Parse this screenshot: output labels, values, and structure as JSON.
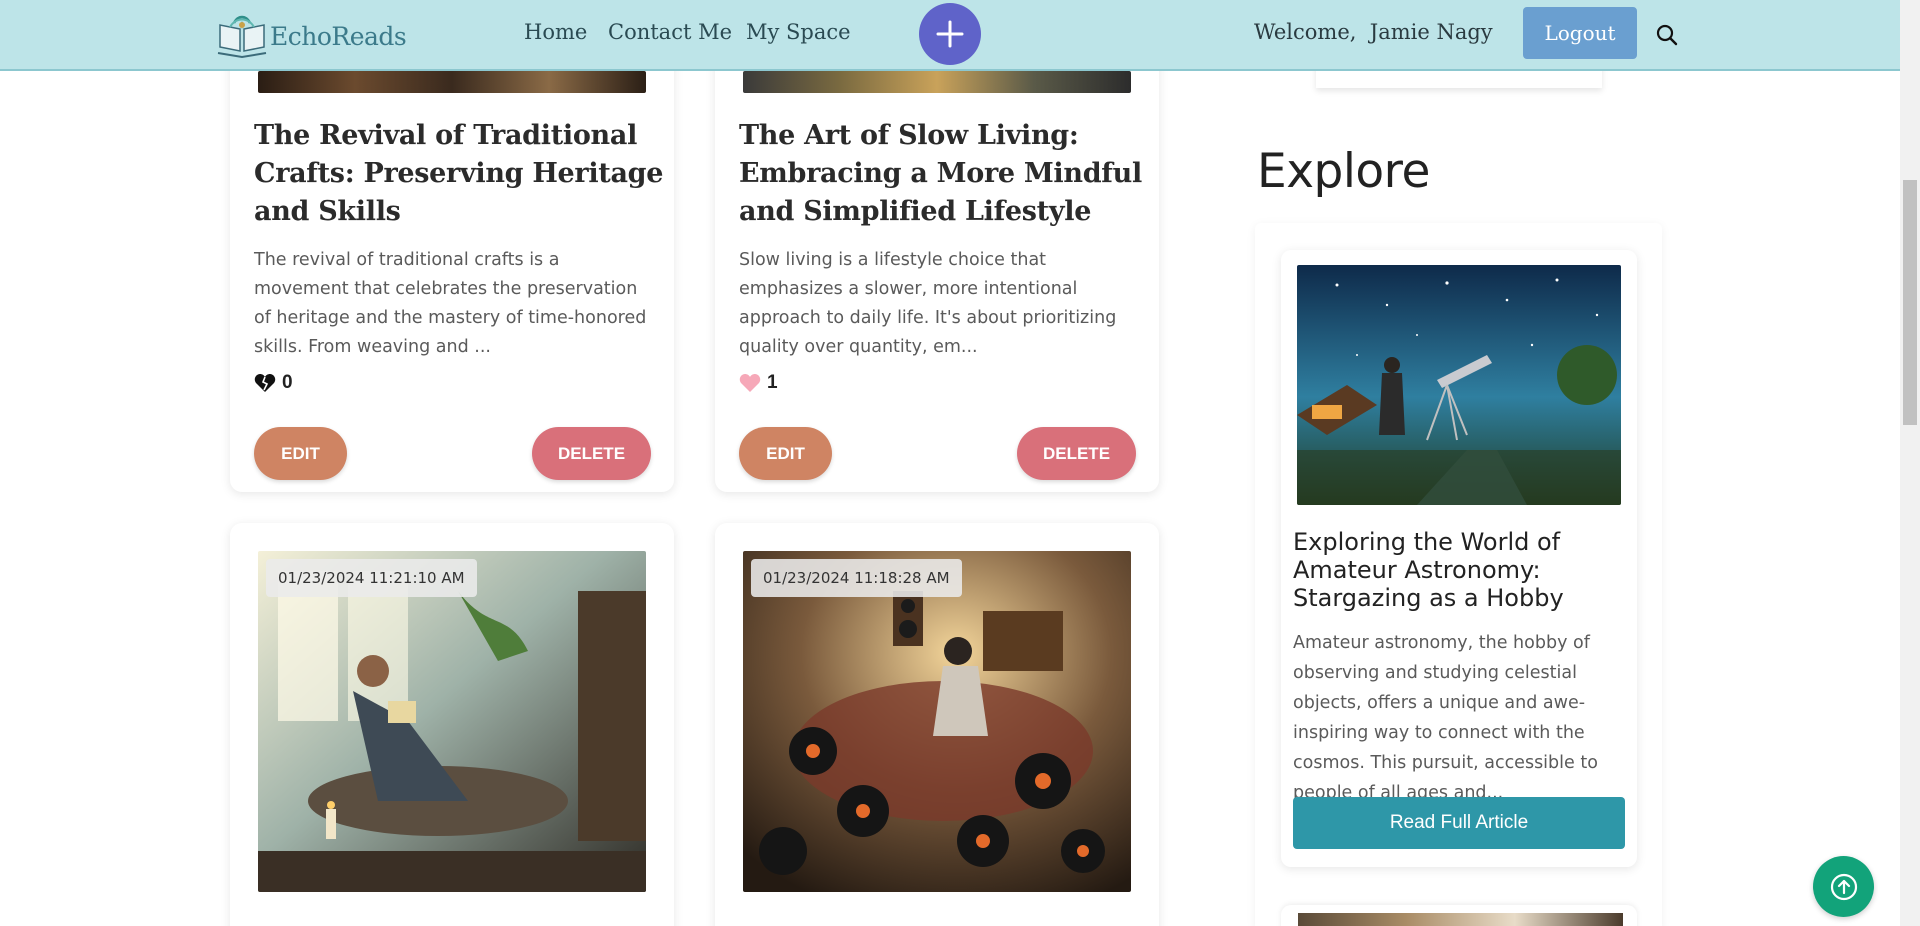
{
  "brand": {
    "name": "EchoReads"
  },
  "nav": {
    "links": [
      "Home",
      "Contact Me",
      "My Space"
    ],
    "add_icon": "plus-icon",
    "welcome_label": "Welcome,",
    "user_name": "Jamie Nagy",
    "logout_label": "Logout",
    "search_icon": "search-icon"
  },
  "my_articles": [
    {
      "title": "The Revival of Traditional Crafts: Preserving Heritage and Skills",
      "excerpt": "The revival of traditional crafts is a movement that celebrates the preservation of heritage and the mastery of time-honored skills. From weaving and ...",
      "likes": "0",
      "liked": false,
      "edit_label": "EDIT",
      "delete_label": "DELETE"
    },
    {
      "title": "The Art of Slow Living: Embracing a More Mindful and Simplified Lifestyle",
      "excerpt": "Slow living is a lifestyle choice that emphasizes a slower, more intentional approach to daily life. It's about prioritizing quality over quantity, em...",
      "likes": "1",
      "liked": true,
      "edit_label": "EDIT",
      "delete_label": "DELETE"
    },
    {
      "date": "01/23/2024 11:21:10 AM"
    },
    {
      "date": "01/23/2024 11:18:28 AM"
    }
  ],
  "explore": {
    "heading": "Explore",
    "article": {
      "title": "Exploring the World of Amateur Astronomy: Stargazing as a Hobby",
      "excerpt": "Amateur astronomy, the hobby of observing and studying celestial objects, offers a unique and awe-inspiring way to connect with the cosmos. This pursuit, accessible to people of all ages and...",
      "button_label": "Read Full Article"
    }
  },
  "colors": {
    "navbar": "#bde4e8",
    "plus_button": "#5f63c9",
    "logout": "#6a9fd0",
    "edit": "#cf8463",
    "delete": "#d9707a",
    "read_button": "#2e97a8",
    "scroll_top": "#12a37a"
  }
}
